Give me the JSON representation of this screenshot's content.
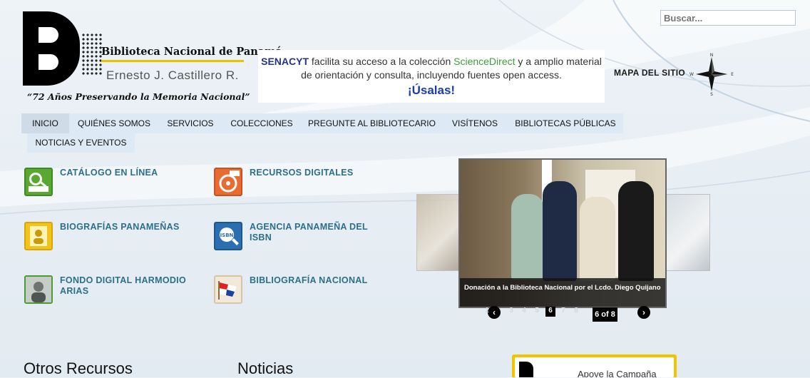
{
  "header": {
    "library_name": "Biblioteca Nacional de Panamá",
    "person_name": "Ernesto J. Castillero R.",
    "motto": "“72 Años Preservando la Memoria Nacional”",
    "search_placeholder": "Buscar...",
    "sitemap_label": "MAPA DEL SITIO",
    "compass_letters": {
      "n": "N",
      "s": "S",
      "e": "E",
      "w": "W"
    }
  },
  "banner": {
    "senacyt": "SENACYT",
    "text1": " facilita su acceso a la colección ",
    "sciencedirect": "ScienceDirect",
    "text2": " y a amplio material de orientación y consulta, incluyendo fuentes open access.",
    "cta": "¡Úsalas!"
  },
  "nav": {
    "items": [
      "INICIO",
      "QUIÉNES SOMOS",
      "SERVICIOS",
      "COLECCIONES",
      "PREGUNTE AL BIBLIOTECARIO",
      "VISÍTENOS",
      "BIBLIOTECAS PÚBLICAS"
    ],
    "second_row": "NOTICIAS Y EVENTOS",
    "active_index": 0
  },
  "resources": [
    {
      "label": "CATÁLOGO EN LÍNEA",
      "icon": "catalog-icon"
    },
    {
      "label": "RECURSOS DIGITALES",
      "icon": "digital-resources-icon"
    },
    {
      "label": "BIOGRAFÍAS PANAMEÑAS",
      "icon": "biography-icon"
    },
    {
      "label": "AGENCIA PANAMEÑA DEL ISBN",
      "icon": "isbn-icon"
    },
    {
      "label": "FONDO DIGITAL HARMODIO ARIAS",
      "icon": "portrait-icon"
    },
    {
      "label": "BIBLIOGRAFÍA NACIONAL",
      "icon": "flag-icon"
    }
  ],
  "slider": {
    "caption": "Donación a la Biblioteca Nacional por el Lcdo. Diego Quijano",
    "current": 6,
    "total": 8,
    "counter": "6 of 8",
    "pages": [
      "1",
      "3",
      "4",
      "5",
      "6",
      "7",
      "8"
    ]
  },
  "bottom": {
    "other_resources": "Otros Recursos",
    "news": "Noticias",
    "campaign": "Apoye la Campaña"
  },
  "colors": {
    "nav_bg": "#dde9f5",
    "link": "#2b6f8a",
    "senacyt": "#23338a",
    "sciencedirect": "#3e9c3a",
    "gold": "#f1c400"
  }
}
